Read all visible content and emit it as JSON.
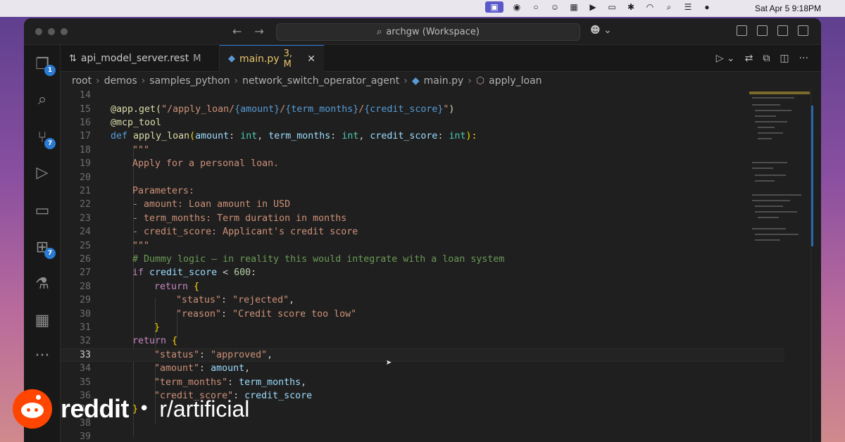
{
  "menubar": {
    "clock": "Sat Apr 5  9:18PM"
  },
  "window": {
    "search_text": "archgw (Workspace)"
  },
  "activity": {
    "explorer_badge": "1",
    "scm_badge": "7",
    "extensions_badge": "7"
  },
  "tabs": [
    {
      "label": "api_model_server.rest",
      "status": "M"
    },
    {
      "label": "main.py",
      "status": "3, M"
    }
  ],
  "breadcrumb": [
    "root",
    "demos",
    "samples_python",
    "network_switch_operator_agent",
    "main.py",
    "apply_loan"
  ],
  "editor": {
    "line_numbers": [
      "14",
      "15",
      "16",
      "17",
      "18",
      "19",
      "20",
      "21",
      "22",
      "23",
      "24",
      "25",
      "26",
      "27",
      "28",
      "29",
      "30",
      "31",
      "32",
      "33",
      "34",
      "35",
      "36",
      "37",
      "38",
      "39"
    ],
    "current_line": "33",
    "l15_dec": "@app.get(",
    "l15_str": "\"/apply_loan/",
    "l15_p1": "{amount}",
    "l15_sl1": "/",
    "l15_p2": "{term_months}",
    "l15_sl2": "/",
    "l15_p3": "{credit_score}",
    "l15_q": "\"",
    "l15_close": ")",
    "l16": "@mcp_tool",
    "l17_def": "def",
    "l17_fn": "apply_loan",
    "l17_open": "(",
    "l17_a1": "amount",
    "l17_c1": ": ",
    "l17_t1": "int",
    "l17_sep1": ", ",
    "l17_a2": "term_months",
    "l17_c2": ": ",
    "l17_t2": "int",
    "l17_sep2": ", ",
    "l17_a3": "credit_score",
    "l17_c3": ": ",
    "l17_t3": "int",
    "l17_close": "):",
    "l18": "\"\"\"",
    "l19": "Apply for a personal loan.",
    "l21": "Parameters:",
    "l22": "- amount: Loan amount in USD",
    "l23": "- term_months: Term duration in months",
    "l24": "- credit_score: Applicant's credit score",
    "l25": "\"\"\"",
    "l26": "# Dummy logic — in reality this would integrate with a loan system",
    "l27_if": "if",
    "l27_var": "credit_score",
    "l27_op": " < ",
    "l27_num": "600",
    "l27_colon": ":",
    "l28_ret": "return",
    "l28_br": " {",
    "l29_key": "\"status\"",
    "l29_colon": ": ",
    "l29_val": "\"rejected\"",
    "l29_comma": ",",
    "l30_key": "\"reason\"",
    "l30_colon": ": ",
    "l30_val": "\"Credit score too low\"",
    "l31": "}",
    "l32_ret": "return",
    "l32_br": " {",
    "l33_key": "\"status\"",
    "l33_colon": ": ",
    "l33_val": "\"approved\"",
    "l33_comma": ",",
    "l34_key": "\"amount\"",
    "l34_colon": ": ",
    "l34_val": "amount",
    "l34_comma": ",",
    "l35_key": "\"term_months\"",
    "l35_colon": ": ",
    "l35_val": "term_months",
    "l35_comma": ",",
    "l36_key": "\"credit_score\"",
    "l36_colon": ": ",
    "l36_val": "credit_score",
    "l37": "}"
  },
  "overlay": {
    "brand": "reddit",
    "dot": "•",
    "subreddit": "r/artificial"
  },
  "colors": {
    "accent": "#2a7bd3",
    "modified": "#e8c46a",
    "reddit": "#ff4500"
  }
}
